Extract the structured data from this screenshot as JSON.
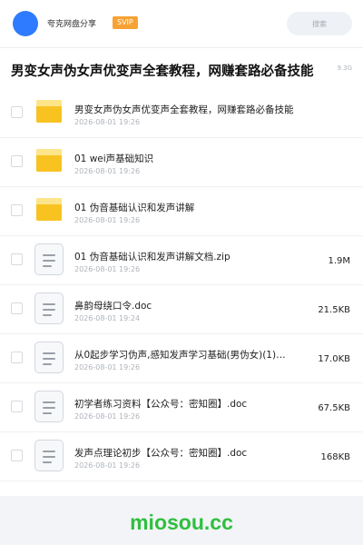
{
  "header": {
    "app_name": "夸克网盘分享",
    "badge": "SVIP",
    "search_placeholder": "搜索"
  },
  "folder": {
    "title": "男变女声伪女声优变声全套教程，网赚套路必备技能",
    "total_size": "9.3G"
  },
  "files": [
    {
      "type": "folder",
      "name": "男变女声伪女声优变声全套教程，网赚套路必备技能",
      "date": "2026-08-01 19:26",
      "size": ""
    },
    {
      "type": "folder",
      "name": "01 wei声基础知识",
      "date": "2026-08-01 19:26",
      "size": ""
    },
    {
      "type": "folder",
      "name": "01 伪音基础认识和发声讲解",
      "date": "2026-08-01 19:26",
      "size": ""
    },
    {
      "type": "doc",
      "name": "01 伪音基础认识和发声讲解文档.zip",
      "date": "2026-08-01 19:26",
      "size": "1.9M"
    },
    {
      "type": "doc",
      "name": "鼻韵母绕口令.doc",
      "date": "2026-08-01 19:24",
      "size": "21.5KB"
    },
    {
      "type": "doc",
      "name": "从0起步学习伪声,感知发声学习基础(男伪女)(1)…",
      "date": "2026-08-01 19:26",
      "size": "17.0KB"
    },
    {
      "type": "doc",
      "name": "初学者练习资料【公众号：密知圈】.doc",
      "date": "2026-08-01 19:26",
      "size": "67.5KB"
    },
    {
      "type": "doc",
      "name": "发声点理论初步【公众号：密知圈】.doc",
      "date": "2026-08-01 19:26",
      "size": "168KB"
    }
  ],
  "watermark": "miosou.cc",
  "colors": {
    "accent": "#2f7bff",
    "svip": "#f7a234",
    "folder": "#f8c320",
    "watermark": "#2fbf3e"
  }
}
